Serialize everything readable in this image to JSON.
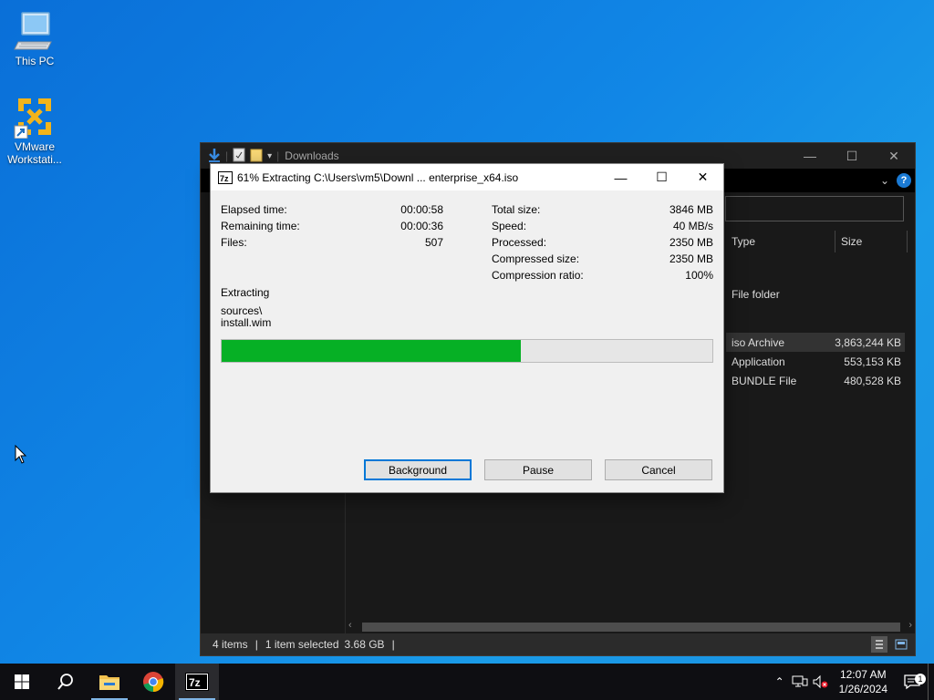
{
  "desktop": {
    "icons": [
      {
        "label": "This PC"
      },
      {
        "label": "VMware Workstati..."
      }
    ]
  },
  "explorer": {
    "title": "Downloads",
    "columns": [
      "Type",
      "Size"
    ],
    "rows": [
      {
        "type": "File folder",
        "size": ""
      },
      {
        "type": "iso Archive",
        "size": "3,863,244 KB",
        "selected": true
      },
      {
        "type": "Application",
        "size": "553,153 KB"
      },
      {
        "type": "BUNDLE File",
        "size": "480,528 KB"
      }
    ],
    "status": {
      "items": "4 items",
      "selected": "1 item selected",
      "selected_size": "3.68 GB"
    }
  },
  "dialog": {
    "title": "61% Extracting C:\\Users\\vm5\\Downl ... enterprise_x64.iso",
    "left_stats": [
      {
        "label": "Elapsed time:",
        "value": "00:00:58"
      },
      {
        "label": "Remaining time:",
        "value": "00:00:36"
      },
      {
        "label": "Files:",
        "value": "507"
      }
    ],
    "right_stats": [
      {
        "label": "Total size:",
        "value": "3846 MB"
      },
      {
        "label": "Speed:",
        "value": "40 MB/s"
      },
      {
        "label": "Processed:",
        "value": "2350 MB"
      },
      {
        "label": "Compressed size:",
        "value": "2350 MB"
      },
      {
        "label": "Compression ratio:",
        "value": "100%"
      }
    ],
    "operation": "Extracting",
    "current_path": "sources\\",
    "current_file": "install.wim",
    "progress_percent": 61,
    "buttons": {
      "background": "Background",
      "pause": "Pause",
      "cancel": "Cancel"
    }
  },
  "taskbar": {
    "apps": [
      "start-icon",
      "search-icon",
      "file-explorer-icon",
      "chrome-icon",
      "7zip-icon"
    ],
    "time": "12:07 AM",
    "date": "1/26/2024",
    "notification_count": "1"
  },
  "colors": {
    "progress_fill": "#06b025",
    "desktop_blue": "#1187e6",
    "focus_border": "#0078d7"
  }
}
